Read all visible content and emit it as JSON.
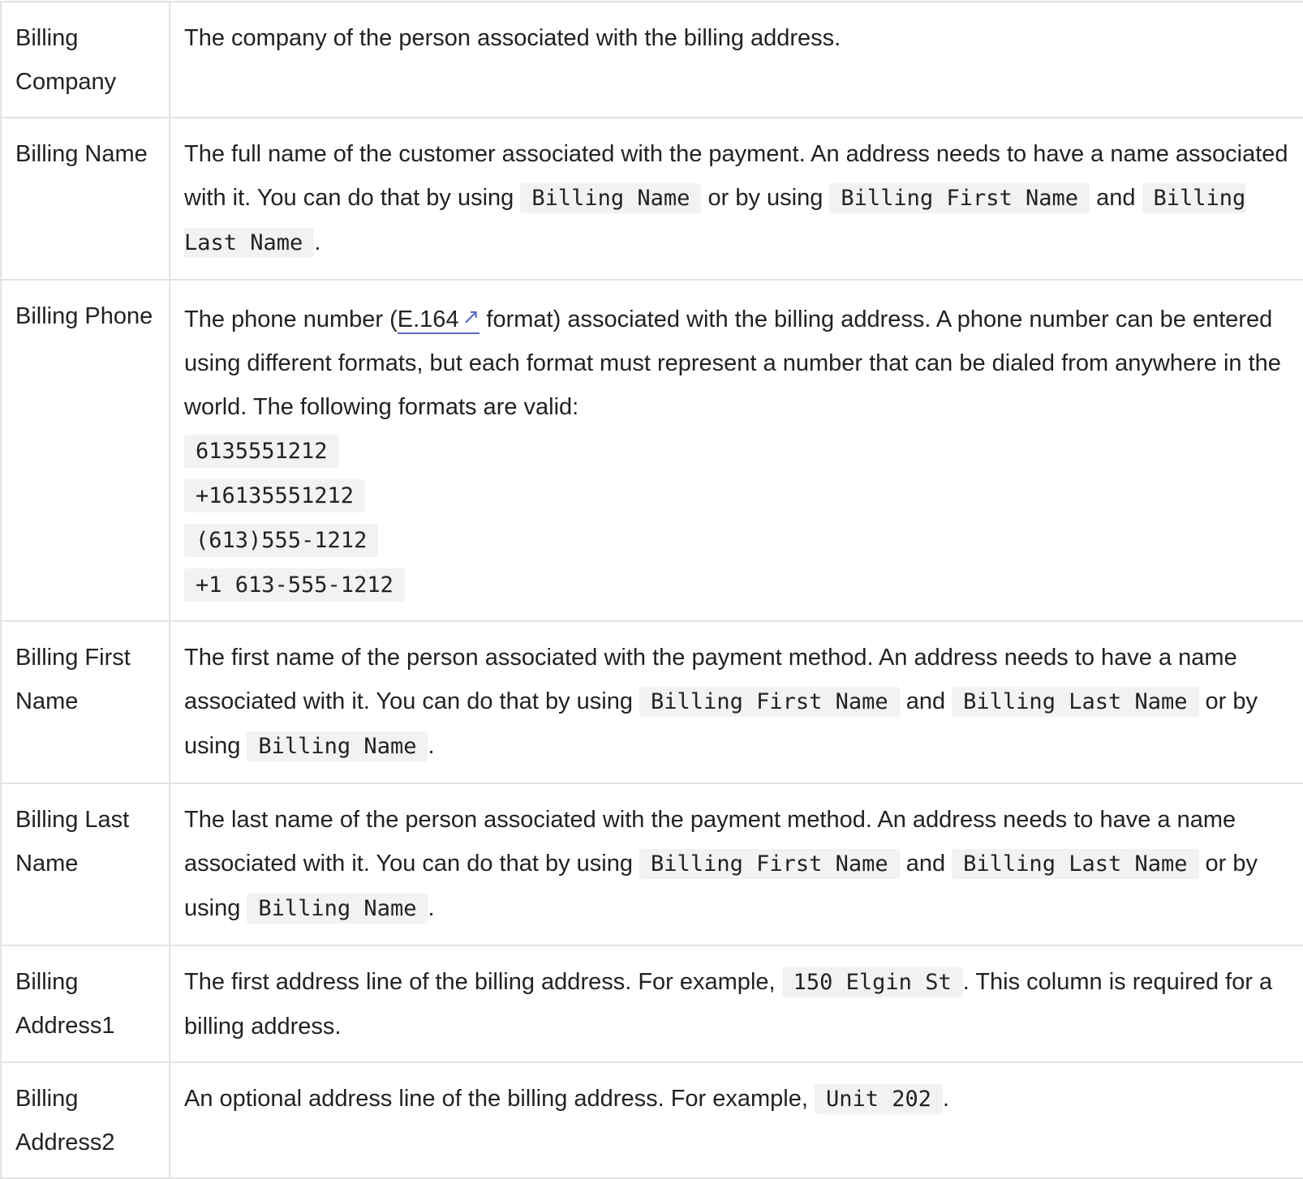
{
  "link_color": "#5c6ac4",
  "rows": [
    {
      "label": "Billing Company",
      "text": [
        "The company of the person associated with the billing address."
      ]
    },
    {
      "label": "Billing Name",
      "text": [
        "The full name of the customer associated with the payment. An address needs to have a name associated with it. You can do that by using ",
        "Billing Name",
        " or by using ",
        "Billing First Name",
        " and ",
        "Billing Last Name",
        "."
      ]
    },
    {
      "label": "Billing Phone",
      "text": [
        "The phone number (",
        "E.164",
        " format) associated with the billing address. A phone number can be entered using different formats, but each format must represent a number that can be dialed from anywhere in the world. The following formats are valid:"
      ],
      "formats": [
        "6135551212",
        "+16135551212",
        "(613)555-1212",
        "+1 613-555-1212"
      ],
      "link_icon": "external-link-icon"
    },
    {
      "label": "Billing First Name",
      "text": [
        "The first name of the person associated with the payment method. An address needs to have a name associated with it. You can do that by using ",
        "Billing First Name",
        " and ",
        "Billing Last Name",
        " or by using ",
        "Billing Name",
        "."
      ]
    },
    {
      "label": "Billing Last Name",
      "text": [
        "The last name of the person associated with the payment method. An address needs to have a name associated with it. You can do that by using ",
        "Billing First Name",
        " and ",
        "Billing Last Name",
        " or by using ",
        "Billing Name",
        "."
      ]
    },
    {
      "label": "Billing Address1",
      "text": [
        "The first address line of the billing address. For example, ",
        "150 Elgin St",
        ". This column is required for a billing address."
      ]
    },
    {
      "label": "Billing Address2",
      "text": [
        "An optional address line of the billing address. For example, ",
        "Unit 202",
        "."
      ]
    }
  ]
}
